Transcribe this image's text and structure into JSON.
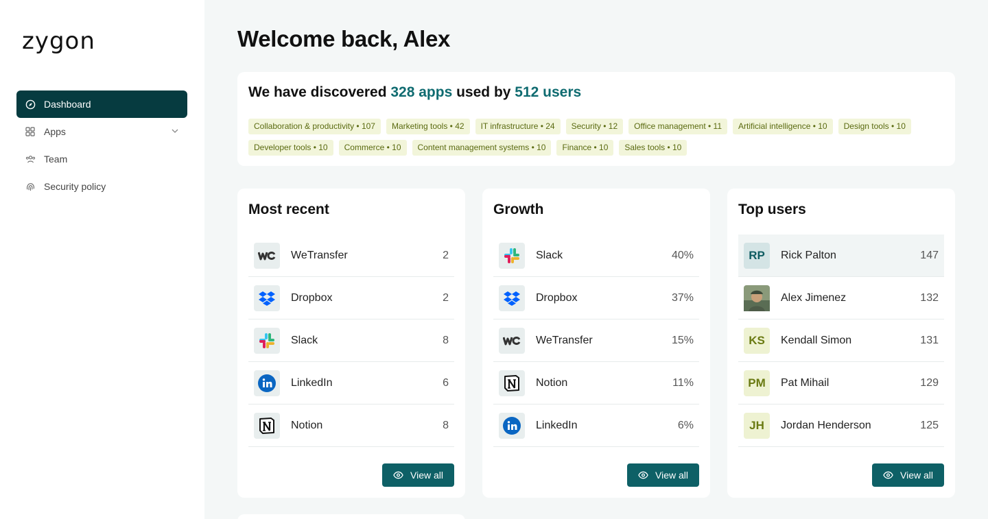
{
  "brand": {
    "logo": "zygon"
  },
  "nav": [
    {
      "label": "Dashboard",
      "icon": "compass-icon",
      "active": true
    },
    {
      "label": "Apps",
      "icon": "grid-icon",
      "has_chevron": true
    },
    {
      "label": "Team",
      "icon": "users-icon"
    },
    {
      "label": "Security policy",
      "icon": "fingerprint-icon"
    }
  ],
  "page": {
    "title": "Welcome back, Alex"
  },
  "discover": {
    "prefix": "We have discovered ",
    "apps": "328 apps",
    "middle": " used by ",
    "users": "512 users",
    "tags": [
      "Collaboration & productivity • 107",
      "Marketing tools • 42",
      "IT infrastructure • 24",
      "Security • 12",
      "Office management • 11",
      "Artificial intelligence • 10",
      "Design tools • 10",
      "Developer tools • 10",
      "Commerce • 10",
      "Content management systems • 10",
      "Finance • 10",
      "Sales tools • 10"
    ]
  },
  "most_recent": {
    "title": "Most recent",
    "rows": [
      {
        "name": "WeTransfer",
        "value": "2",
        "icon": "wetransfer-icon"
      },
      {
        "name": "Dropbox",
        "value": "2",
        "icon": "dropbox-icon"
      },
      {
        "name": "Slack",
        "value": "8",
        "icon": "slack-icon"
      },
      {
        "name": "LinkedIn",
        "value": "6",
        "icon": "linkedin-icon"
      },
      {
        "name": "Notion",
        "value": "8",
        "icon": "notion-icon"
      }
    ],
    "button": "View all"
  },
  "growth": {
    "title": "Growth",
    "rows": [
      {
        "name": "Slack",
        "value": "40%",
        "icon": "slack-icon"
      },
      {
        "name": "Dropbox",
        "value": "37%",
        "icon": "dropbox-icon"
      },
      {
        "name": "WeTransfer",
        "value": "15%",
        "icon": "wetransfer-icon"
      },
      {
        "name": "Notion",
        "value": "11%",
        "icon": "notion-icon"
      },
      {
        "name": "LinkedIn",
        "value": "6%",
        "icon": "linkedin-icon"
      }
    ],
    "button": "View all"
  },
  "top_users": {
    "title": "Top users",
    "rows": [
      {
        "initials": "RP",
        "name": "Rick Palton",
        "value": "147",
        "bg": "#d4e4e5",
        "fg": "#0f5c61"
      },
      {
        "initials": "",
        "name": "Alex Jimenez",
        "value": "132",
        "photo": true
      },
      {
        "initials": "KS",
        "name": "Kendall Simon",
        "value": "131",
        "bg": "#eef2d2",
        "fg": "#6a7a12"
      },
      {
        "initials": "PM",
        "name": "Pat Mihail",
        "value": "129",
        "bg": "#eef2d2",
        "fg": "#6a7a12"
      },
      {
        "initials": "JH",
        "name": "Jordan Henderson",
        "value": "125",
        "bg": "#eef2d2",
        "fg": "#6a7a12"
      }
    ],
    "button": "View all"
  },
  "colors": {
    "accent": "#0e6066",
    "sidebar_active": "#063b40",
    "highlight_text": "#0f6b70",
    "tag_bg": "#f2f5da",
    "tag_text": "#5a6a10"
  }
}
